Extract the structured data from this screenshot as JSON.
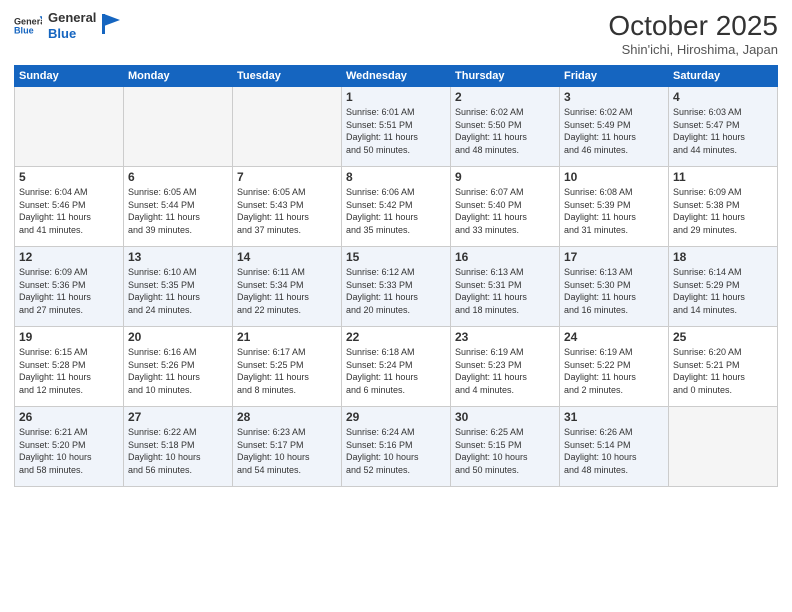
{
  "logo": {
    "line1": "General",
    "line2": "Blue"
  },
  "header": {
    "month": "October 2025",
    "location": "Shin'ichi, Hiroshima, Japan"
  },
  "days_of_week": [
    "Sunday",
    "Monday",
    "Tuesday",
    "Wednesday",
    "Thursday",
    "Friday",
    "Saturday"
  ],
  "weeks": [
    [
      {
        "day": "",
        "info": ""
      },
      {
        "day": "",
        "info": ""
      },
      {
        "day": "",
        "info": ""
      },
      {
        "day": "1",
        "info": "Sunrise: 6:01 AM\nSunset: 5:51 PM\nDaylight: 11 hours\nand 50 minutes."
      },
      {
        "day": "2",
        "info": "Sunrise: 6:02 AM\nSunset: 5:50 PM\nDaylight: 11 hours\nand 48 minutes."
      },
      {
        "day": "3",
        "info": "Sunrise: 6:02 AM\nSunset: 5:49 PM\nDaylight: 11 hours\nand 46 minutes."
      },
      {
        "day": "4",
        "info": "Sunrise: 6:03 AM\nSunset: 5:47 PM\nDaylight: 11 hours\nand 44 minutes."
      }
    ],
    [
      {
        "day": "5",
        "info": "Sunrise: 6:04 AM\nSunset: 5:46 PM\nDaylight: 11 hours\nand 41 minutes."
      },
      {
        "day": "6",
        "info": "Sunrise: 6:05 AM\nSunset: 5:44 PM\nDaylight: 11 hours\nand 39 minutes."
      },
      {
        "day": "7",
        "info": "Sunrise: 6:05 AM\nSunset: 5:43 PM\nDaylight: 11 hours\nand 37 minutes."
      },
      {
        "day": "8",
        "info": "Sunrise: 6:06 AM\nSunset: 5:42 PM\nDaylight: 11 hours\nand 35 minutes."
      },
      {
        "day": "9",
        "info": "Sunrise: 6:07 AM\nSunset: 5:40 PM\nDaylight: 11 hours\nand 33 minutes."
      },
      {
        "day": "10",
        "info": "Sunrise: 6:08 AM\nSunset: 5:39 PM\nDaylight: 11 hours\nand 31 minutes."
      },
      {
        "day": "11",
        "info": "Sunrise: 6:09 AM\nSunset: 5:38 PM\nDaylight: 11 hours\nand 29 minutes."
      }
    ],
    [
      {
        "day": "12",
        "info": "Sunrise: 6:09 AM\nSunset: 5:36 PM\nDaylight: 11 hours\nand 27 minutes."
      },
      {
        "day": "13",
        "info": "Sunrise: 6:10 AM\nSunset: 5:35 PM\nDaylight: 11 hours\nand 24 minutes."
      },
      {
        "day": "14",
        "info": "Sunrise: 6:11 AM\nSunset: 5:34 PM\nDaylight: 11 hours\nand 22 minutes."
      },
      {
        "day": "15",
        "info": "Sunrise: 6:12 AM\nSunset: 5:33 PM\nDaylight: 11 hours\nand 20 minutes."
      },
      {
        "day": "16",
        "info": "Sunrise: 6:13 AM\nSunset: 5:31 PM\nDaylight: 11 hours\nand 18 minutes."
      },
      {
        "day": "17",
        "info": "Sunrise: 6:13 AM\nSunset: 5:30 PM\nDaylight: 11 hours\nand 16 minutes."
      },
      {
        "day": "18",
        "info": "Sunrise: 6:14 AM\nSunset: 5:29 PM\nDaylight: 11 hours\nand 14 minutes."
      }
    ],
    [
      {
        "day": "19",
        "info": "Sunrise: 6:15 AM\nSunset: 5:28 PM\nDaylight: 11 hours\nand 12 minutes."
      },
      {
        "day": "20",
        "info": "Sunrise: 6:16 AM\nSunset: 5:26 PM\nDaylight: 11 hours\nand 10 minutes."
      },
      {
        "day": "21",
        "info": "Sunrise: 6:17 AM\nSunset: 5:25 PM\nDaylight: 11 hours\nand 8 minutes."
      },
      {
        "day": "22",
        "info": "Sunrise: 6:18 AM\nSunset: 5:24 PM\nDaylight: 11 hours\nand 6 minutes."
      },
      {
        "day": "23",
        "info": "Sunrise: 6:19 AM\nSunset: 5:23 PM\nDaylight: 11 hours\nand 4 minutes."
      },
      {
        "day": "24",
        "info": "Sunrise: 6:19 AM\nSunset: 5:22 PM\nDaylight: 11 hours\nand 2 minutes."
      },
      {
        "day": "25",
        "info": "Sunrise: 6:20 AM\nSunset: 5:21 PM\nDaylight: 11 hours\nand 0 minutes."
      }
    ],
    [
      {
        "day": "26",
        "info": "Sunrise: 6:21 AM\nSunset: 5:20 PM\nDaylight: 10 hours\nand 58 minutes."
      },
      {
        "day": "27",
        "info": "Sunrise: 6:22 AM\nSunset: 5:18 PM\nDaylight: 10 hours\nand 56 minutes."
      },
      {
        "day": "28",
        "info": "Sunrise: 6:23 AM\nSunset: 5:17 PM\nDaylight: 10 hours\nand 54 minutes."
      },
      {
        "day": "29",
        "info": "Sunrise: 6:24 AM\nSunset: 5:16 PM\nDaylight: 10 hours\nand 52 minutes."
      },
      {
        "day": "30",
        "info": "Sunrise: 6:25 AM\nSunset: 5:15 PM\nDaylight: 10 hours\nand 50 minutes."
      },
      {
        "day": "31",
        "info": "Sunrise: 6:26 AM\nSunset: 5:14 PM\nDaylight: 10 hours\nand 48 minutes."
      },
      {
        "day": "",
        "info": ""
      }
    ]
  ]
}
